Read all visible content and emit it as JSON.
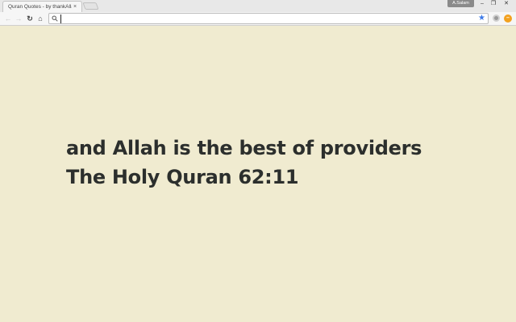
{
  "browser": {
    "tab_title": "Quran Quotes - by thankAllah",
    "tab_close": "×",
    "profile_name": "A.Salam",
    "window_controls": [
      "–",
      "❐",
      "✕"
    ],
    "nav": {
      "back": "←",
      "forward": "→",
      "reload": "↻",
      "home": "⌂"
    },
    "address_value": "",
    "bookmark_star": "★",
    "ext_orange": "–"
  },
  "quote": {
    "text": "and Allah is the best of providers",
    "reference": "The Holy Quran 62:11"
  },
  "colors": {
    "background": "#f0ebd0",
    "text": "#2c2f2d",
    "star": "#3d7ae8"
  }
}
